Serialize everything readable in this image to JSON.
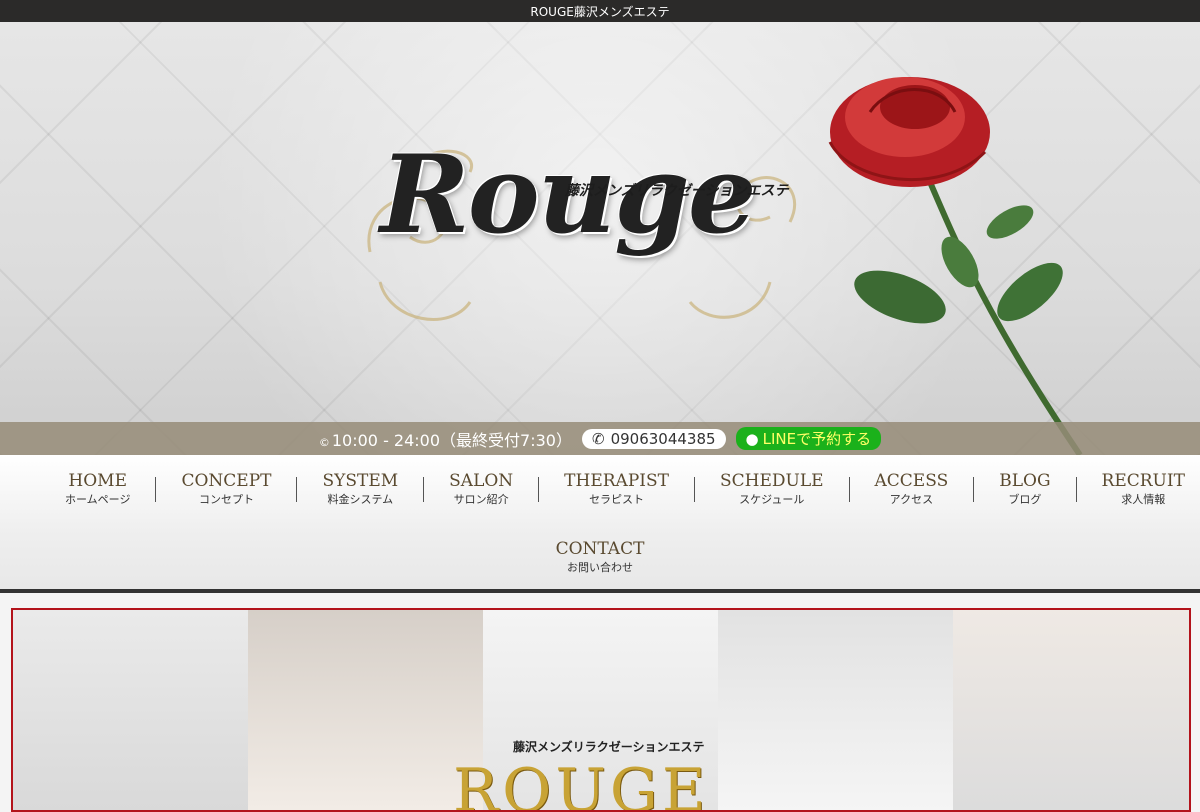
{
  "topbar": {
    "title": "ROUGE藤沢メンズエステ"
  },
  "hero": {
    "logo_word": "Rouge",
    "logo_sub": "藤沢メンズリラクゼーションエステ"
  },
  "info": {
    "hours": "10:00 - 24:00",
    "hours_note": "（最終受付7:30）",
    "phone": "09063044385",
    "line_label": "LINEで予約する"
  },
  "nav": {
    "items": [
      {
        "en": "HOME",
        "jp": "ホームページ"
      },
      {
        "en": "CONCEPT",
        "jp": "コンセプト"
      },
      {
        "en": "SYSTEM",
        "jp": "料金システム"
      },
      {
        "en": "SALON",
        "jp": "サロン紹介"
      },
      {
        "en": "THERAPIST",
        "jp": "セラピスト"
      },
      {
        "en": "SCHEDULE",
        "jp": "スケジュール"
      },
      {
        "en": "ACCESS",
        "jp": "アクセス"
      },
      {
        "en": "BLOG",
        "jp": "ブログ"
      },
      {
        "en": "RECRUIT",
        "jp": "求人情報"
      }
    ],
    "contact": {
      "en": "CONTACT",
      "jp": "お問い合わせ"
    }
  },
  "banner": {
    "sub": "藤沢メンズリラクゼーションエステ",
    "brand": "ROUGE"
  },
  "colors": {
    "accent_red": "#b3131b",
    "line_green": "#1bb11b",
    "nav_text": "#5a4a30"
  }
}
